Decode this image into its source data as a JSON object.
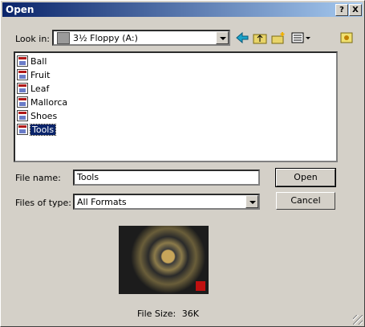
{
  "window": {
    "title": "Open",
    "help_button": "?",
    "close_button": "X"
  },
  "look_in": {
    "label": "Look in:",
    "value": "3½ Floppy (A:)"
  },
  "toolbar": {
    "back_icon": "back-arrow-icon",
    "up_icon": "up-folder-icon",
    "new_folder_icon": "new-folder-icon",
    "view_menu_icon": "view-menu-icon",
    "extra_icon": "preview-toggle-icon"
  },
  "files": [
    {
      "name": "Ball"
    },
    {
      "name": "Fruit"
    },
    {
      "name": "Leaf"
    },
    {
      "name": "Mallorca"
    },
    {
      "name": "Shoes"
    },
    {
      "name": "Tools"
    }
  ],
  "selected_file": "Tools",
  "file_name": {
    "label": "File name:",
    "value": "Tools"
  },
  "files_of_type": {
    "label": "Files of type:",
    "value": "All Formats"
  },
  "buttons": {
    "open": "Open",
    "cancel": "Cancel"
  },
  "preview": {
    "file_size_label": "File Size:",
    "file_size_value": "36K"
  }
}
